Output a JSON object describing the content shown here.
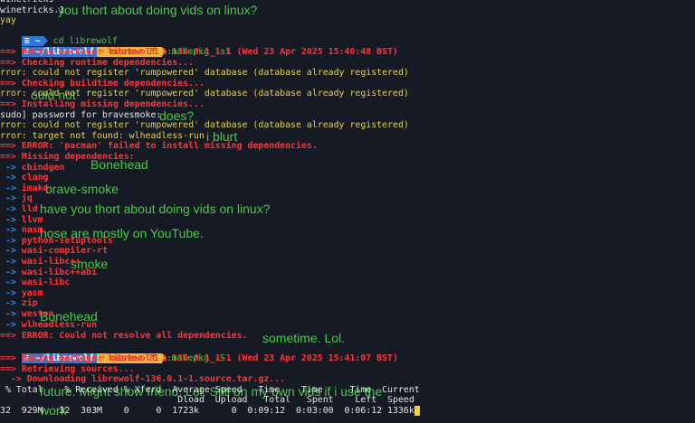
{
  "ghost": [
    "you thort about doing vids on linux?",
    "ould not",
    "does?",
    "i blurt",
    "Bonehead",
    "brave-smoke",
    "have you thort about doing vids on linux?",
    "hose are mostly on YouTube.",
    "smoke",
    "Bonehead",
    "sometime. Lol.",
    "future. Might show friend. Lol. Still on my own vids if i use the",
    "work"
  ],
  "prompt": {
    "icon": "≡",
    "home": "~",
    "dir": "~/librewolf",
    "branch": "master ?1"
  },
  "lines": {
    "l0": "winetricks",
    "l1": "winetricks.1",
    "l2": "yay",
    "l3_cmd": "cd librewolf",
    "l4_cmd": "makepkg -si",
    "l5": "==> Making package: librewolf 1:136.0.1_1-1 (Wed 23 Apr 2025 15:40:48 BST)",
    "l6": "==> Checking runtime dependencies...",
    "l7": "rror: could not register 'rumpowered' database (database already registered)",
    "l8": "==> Checking buildtime dependencies...",
    "l9": "rror: could not register 'rumpowered' database (database already registered)",
    "l10": "==> Installing missing dependencies...",
    "l11": "sudo] password for bravesmoke:",
    "l12": "rror: could not register 'rumpowered' database (database already registered)",
    "l13": "rror: target not found: wlheadless-run",
    "l14": "==> ERROR: 'pacman' failed to install missing dependencies.",
    "l15": "==> Missing dependencies:",
    "deps": [
      "cbindgen",
      "clang",
      "imake",
      "jq",
      "lld",
      "llvm",
      "nasm",
      "python-setuptools",
      "wasi-compiler-rt",
      "wasi-libc++",
      "wasi-libc++abi",
      "wasi-libc",
      "yasm",
      "zip",
      "weston",
      "wlheadless-run"
    ],
    "l32": "==> ERROR: Could not resolve all dependencies.",
    "l34_cmd": "makepkg -S",
    "l35": "==> Making package: librewolf 1:136.0.1_1-1 (Wed 23 Apr 2025 15:41:07 BST)",
    "l36": "==> Retrieving sources...",
    "l37": "  -> Downloading librewolf-136.0.1-1.source.tar.gz...",
    "h1": " % Total    % Received % Xferd  Average Speed   Time    Time     Time  Current",
    "h2": "                                 Dload  Upload   Total   Spent    Left  Speed",
    "h3": "32  929M   32  303M    0     0  1723k      0  0:09:12  0:03:00  0:06:12 1336k"
  }
}
